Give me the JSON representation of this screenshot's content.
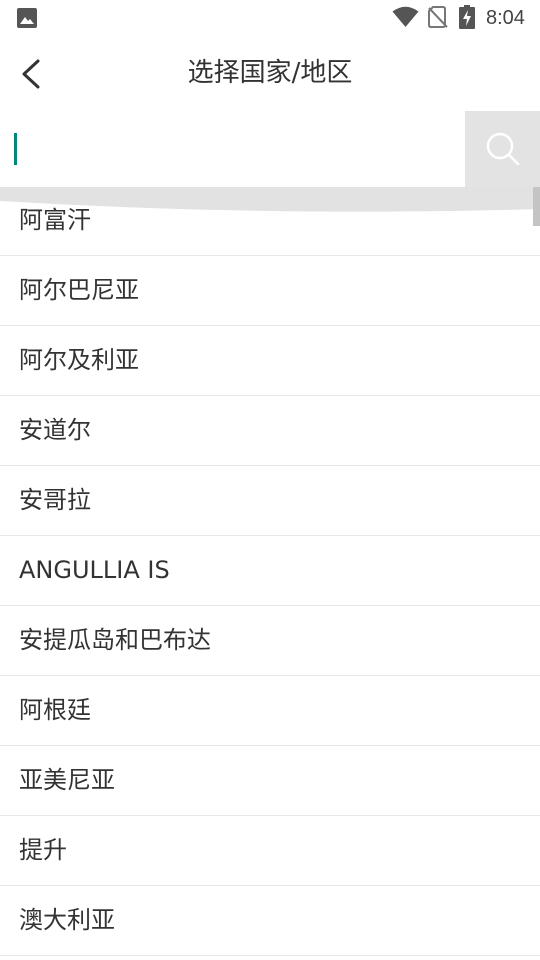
{
  "status_bar": {
    "time": "8:04",
    "icons": [
      "gallery-icon",
      "wifi-icon",
      "no-sim-icon",
      "battery-charging-icon"
    ]
  },
  "header": {
    "title": "选择国家/地区",
    "back_icon": "chevron-left-icon"
  },
  "search": {
    "value": "",
    "placeholder": "",
    "button_icon": "search-icon"
  },
  "colors": {
    "caret": "#00897b",
    "search_button_bg": "#e3e3e3",
    "divider": "#e8e8e8",
    "text": "#333333"
  },
  "countries": [
    "阿富汗",
    "阿尔巴尼亚",
    "阿尔及利亚",
    "安道尔",
    "安哥拉",
    "ANGULLIA IS",
    "安提瓜岛和巴布达",
    "阿根廷",
    "亚美尼亚",
    "提升",
    "澳大利亚"
  ]
}
